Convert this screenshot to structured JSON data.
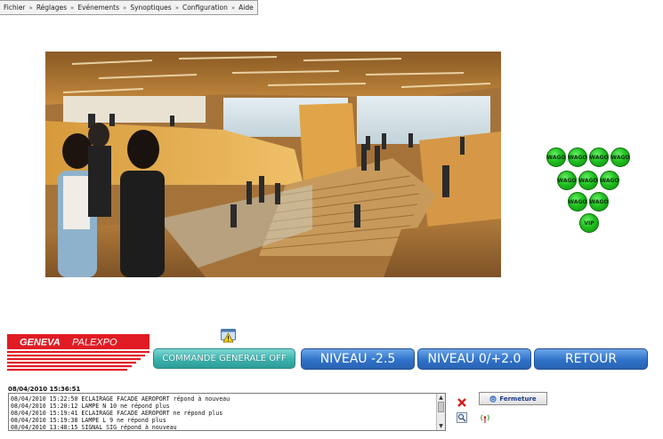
{
  "menubar": {
    "items": [
      "Fichier",
      "Réglages",
      "Evénements",
      "Synoptiques",
      "Configuration",
      "Aide"
    ],
    "separator": "»"
  },
  "hero": {
    "description_icon": "photo-venue-interior"
  },
  "wago": {
    "buttons": [
      "WAGO",
      "WAGO",
      "WAGO",
      "WAGO",
      "WAGO",
      "WAGO",
      "WAGO",
      "WAGO",
      "WAGO",
      "VIP"
    ],
    "color": "#20c020"
  },
  "logo": {
    "text_left": "GENEVA",
    "text_right": "PALEXPO",
    "brand_color": "#e01b24"
  },
  "buttons": {
    "commande": "COMMANDE GENERALE OFF",
    "niveau_m25": "NIVEAU -2.5",
    "niveau_0_2": "NIVEAU 0/+2.0",
    "retour": "RETOUR",
    "fermeture": "Fermeture"
  },
  "status": {
    "datetime": "08/04/2010 15:36:51",
    "log": [
      "08/04/2010 15:22:50 ECLAIRAGE FACADE AEROPORT répond à nouveau",
      "08/04/2010 15:20:12 LAMPE N 10 ne répond plus",
      "08/04/2010 15:19:41 ECLAIRAGE FACADE AEROPORT ne répond plus",
      "08/04/2010 15:19:38 LAMPE L 9 ne répond plus",
      "08/04/2010 13:48:15 SIGNAL SIG répond à nouveau"
    ]
  },
  "colors": {
    "teal": "#3ab1ad",
    "blue": "#2f72c9"
  }
}
